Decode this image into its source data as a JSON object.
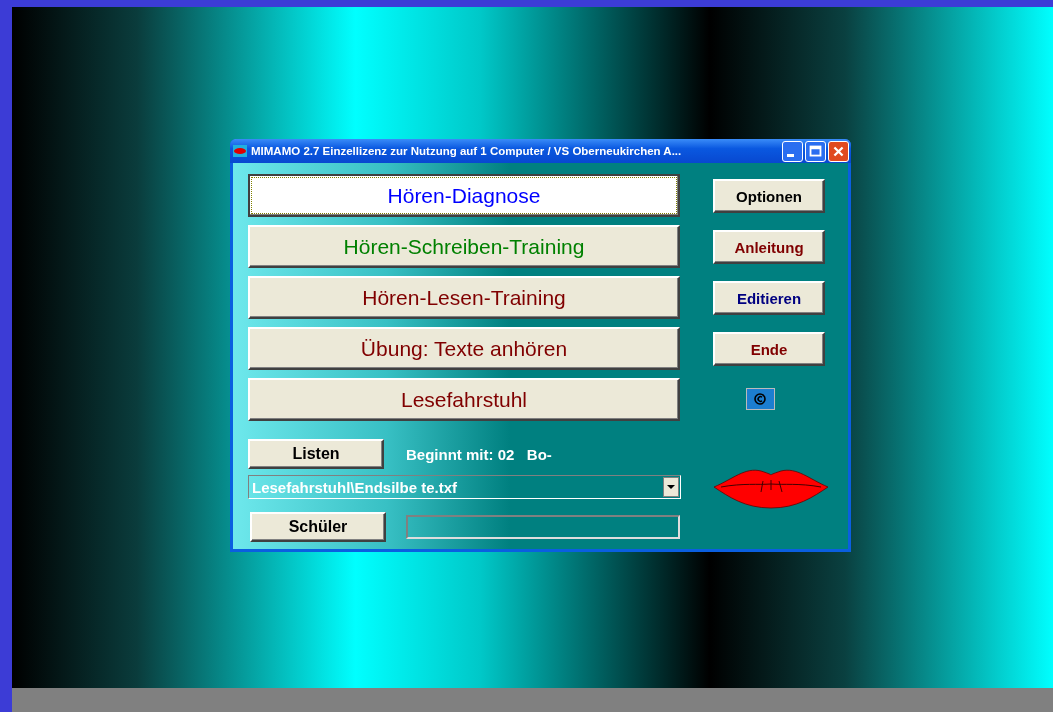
{
  "window": {
    "title": "MIMAMO 2.7  Einzellizenz zur Nutzung auf 1 Computer / VS Oberneukirchen  A..."
  },
  "main_buttons": [
    {
      "label": "Hören-Diagnose",
      "color": "#0000ff",
      "selected": true
    },
    {
      "label": "Hören-Schreiben-Training",
      "color": "#008000",
      "selected": false
    },
    {
      "label": "Hören-Lesen-Training",
      "color": "#800000",
      "selected": false
    },
    {
      "label": "Übung: Texte anhören",
      "color": "#800000",
      "selected": false
    },
    {
      "label": "Lesefahrstuhl",
      "color": "#800000",
      "selected": false
    }
  ],
  "side_buttons": [
    {
      "label": "Optionen",
      "color": "#000000"
    },
    {
      "label": "Anleitung",
      "color": "#800000"
    },
    {
      "label": "Editieren",
      "color": "#000080"
    },
    {
      "label": "Ende",
      "color": "#800000"
    }
  ],
  "lists_button": "Listen",
  "start_label": "Beginnt mit: 02   Bo-",
  "list_select": {
    "value": "Lesefahrstuhl\\Endsilbe te.txf"
  },
  "student_button": "Schüler"
}
